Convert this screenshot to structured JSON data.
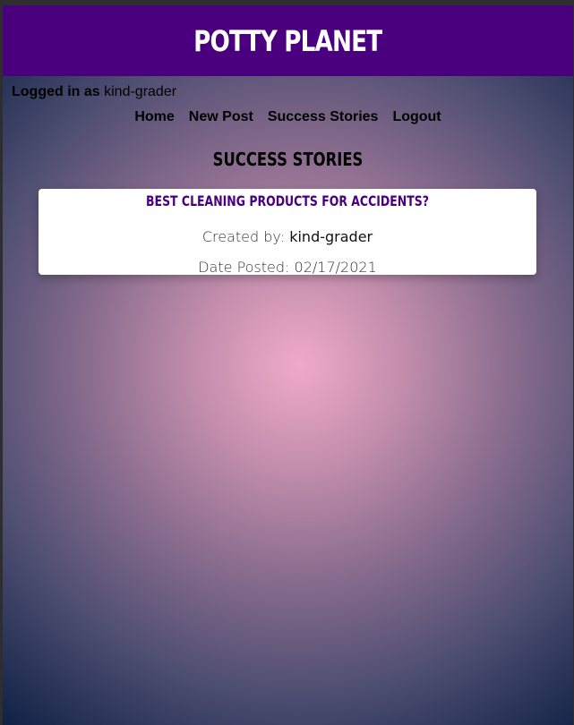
{
  "header": {
    "title": "POTTY PLANET"
  },
  "session": {
    "label": "Logged in as",
    "username": "kind-grader"
  },
  "nav": {
    "items": [
      {
        "label": "Home"
      },
      {
        "label": "New Post"
      },
      {
        "label": "Success Stories"
      },
      {
        "label": "Logout"
      }
    ]
  },
  "main": {
    "section_title": "SUCCESS STORIES",
    "posts": [
      {
        "title": "BEST CLEANING PRODUCTS FOR ACCIDENTS?",
        "created_label": "Created by:",
        "author": "kind-grader",
        "date_label": "Date Posted:",
        "date": "02/17/2021"
      }
    ]
  },
  "colors": {
    "header_bg": "#4a007e",
    "card_title": "#4a007e",
    "gradient_center": "#eeaac8",
    "gradient_edge": "#0f2145"
  }
}
